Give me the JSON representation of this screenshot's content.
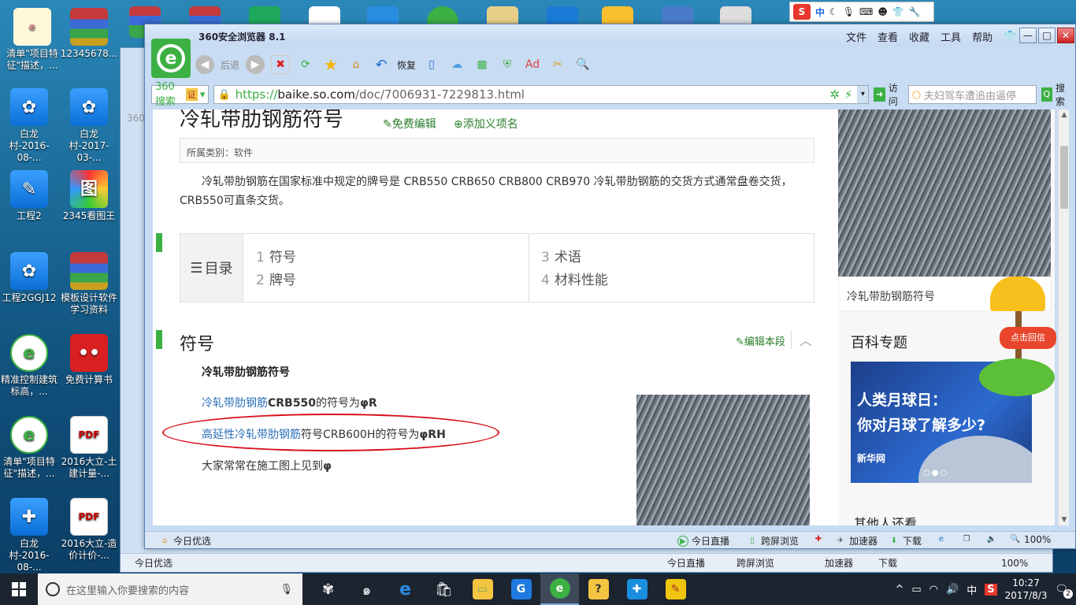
{
  "desktop": {
    "icons": [
      {
        "label": "清单\"项目特征\"描述，...",
        "kind": "doc"
      },
      {
        "label": "12345678...",
        "kind": "rar"
      },
      {
        "label": "白龙村-2016-08-...",
        "kind": "blue"
      },
      {
        "label": "白龙村-2017-03-...",
        "kind": "blue"
      },
      {
        "label": "工程2",
        "kind": "blue"
      },
      {
        "label": "2345看图王",
        "kind": "blue"
      },
      {
        "label": "工程2GGJ12",
        "kind": "blue"
      },
      {
        "label": "模板设计软件学习资料",
        "kind": "rar"
      },
      {
        "label": "精准控制建筑标高，...",
        "kind": "green"
      },
      {
        "label": "免费计算书",
        "kind": "red"
      },
      {
        "label": "清单\"项目特征\"描述，...",
        "kind": "green"
      },
      {
        "label": "2016大立-土建计量-...",
        "kind": "pdf"
      },
      {
        "label": "白龙村-2016-08-...",
        "kind": "blue"
      },
      {
        "label": "2016大立-造价计价-...",
        "kind": "pdf"
      }
    ],
    "ime": {
      "label_zh": "中",
      "icons": [
        "moon-icon",
        "mic-icon",
        "keyboard-icon",
        "person-icon",
        "shirt-icon",
        "wrench-icon"
      ]
    }
  },
  "back_window": {
    "tab_fragment": "360",
    "status": {
      "left": "今日优选",
      "live": "今日直播",
      "cross": "跨屏浏览",
      "accel": "加速器",
      "download": "下载",
      "zoom": "100%"
    }
  },
  "browser": {
    "title": "360安全浏览器 8.1",
    "menu": [
      "文件",
      "查看",
      "收藏",
      "工具",
      "帮助"
    ],
    "toolbar": {
      "back": "后退",
      "restore": "恢复"
    },
    "search_engine": "360搜索",
    "search_engine_badge": "证",
    "url": {
      "protocol": "https://",
      "host": "baike.so.com",
      "path": "/doc/7006931-7229813.html"
    },
    "visit_label": "访问",
    "search_placeholder": "夫妇驾车遭追由逼停",
    "search_button": "搜索",
    "status": {
      "left": "今日优选",
      "live": "今日直播",
      "cross": "跨屏浏览",
      "accel": "加速器",
      "download": "下载",
      "zoom": "100%"
    }
  },
  "article": {
    "title": "冷轧带肋钢筋符号",
    "edit_free": "免费编辑",
    "add_meaning": "添加义项名",
    "category": "所属类别：软件",
    "intro": "冷轧带肋钢筋在国家标准中规定的牌号是 CRB550 CRB650 CRB800 CRB970 冷轧带肋钢筋的交货方式通常盘卷交货，CRB550可直条交货。",
    "toc_label": "目录",
    "toc": [
      {
        "num": "1",
        "text": "符号"
      },
      {
        "num": "2",
        "text": "牌号"
      },
      {
        "num": "3",
        "text": "术语"
      },
      {
        "num": "4",
        "text": "材料性能"
      }
    ],
    "section_title": "符号",
    "section_edit": "编辑本段",
    "subheading": "冷轧带肋钢筋符号",
    "p1": {
      "link": "冷轧带肋钢筋",
      "rest_bold": "CRB550",
      "rest": "的符号为",
      "sym": "φR"
    },
    "p2": {
      "link": "高延性冷轧带肋钢筋",
      "rest": "符号CRB600H的符号为",
      "sym": "φRH"
    },
    "p3": {
      "text": "大家常常在施工图上见到",
      "sym": "φ"
    }
  },
  "sidebar": {
    "caption": "冷轧带肋钢筋符号",
    "topic_title": "百科专题",
    "promo_line1": "人类月球日：",
    "promo_line2": "你对月球了解多少?",
    "promo_brand": "新华网",
    "other_title": "其他人还看",
    "mail_tag": "点击回信"
  },
  "taskbar": {
    "search_placeholder": "在这里输入你要搜索的内容",
    "ime": "中",
    "time": "10:27",
    "date": "2017/8/3",
    "notify_count": "2"
  }
}
